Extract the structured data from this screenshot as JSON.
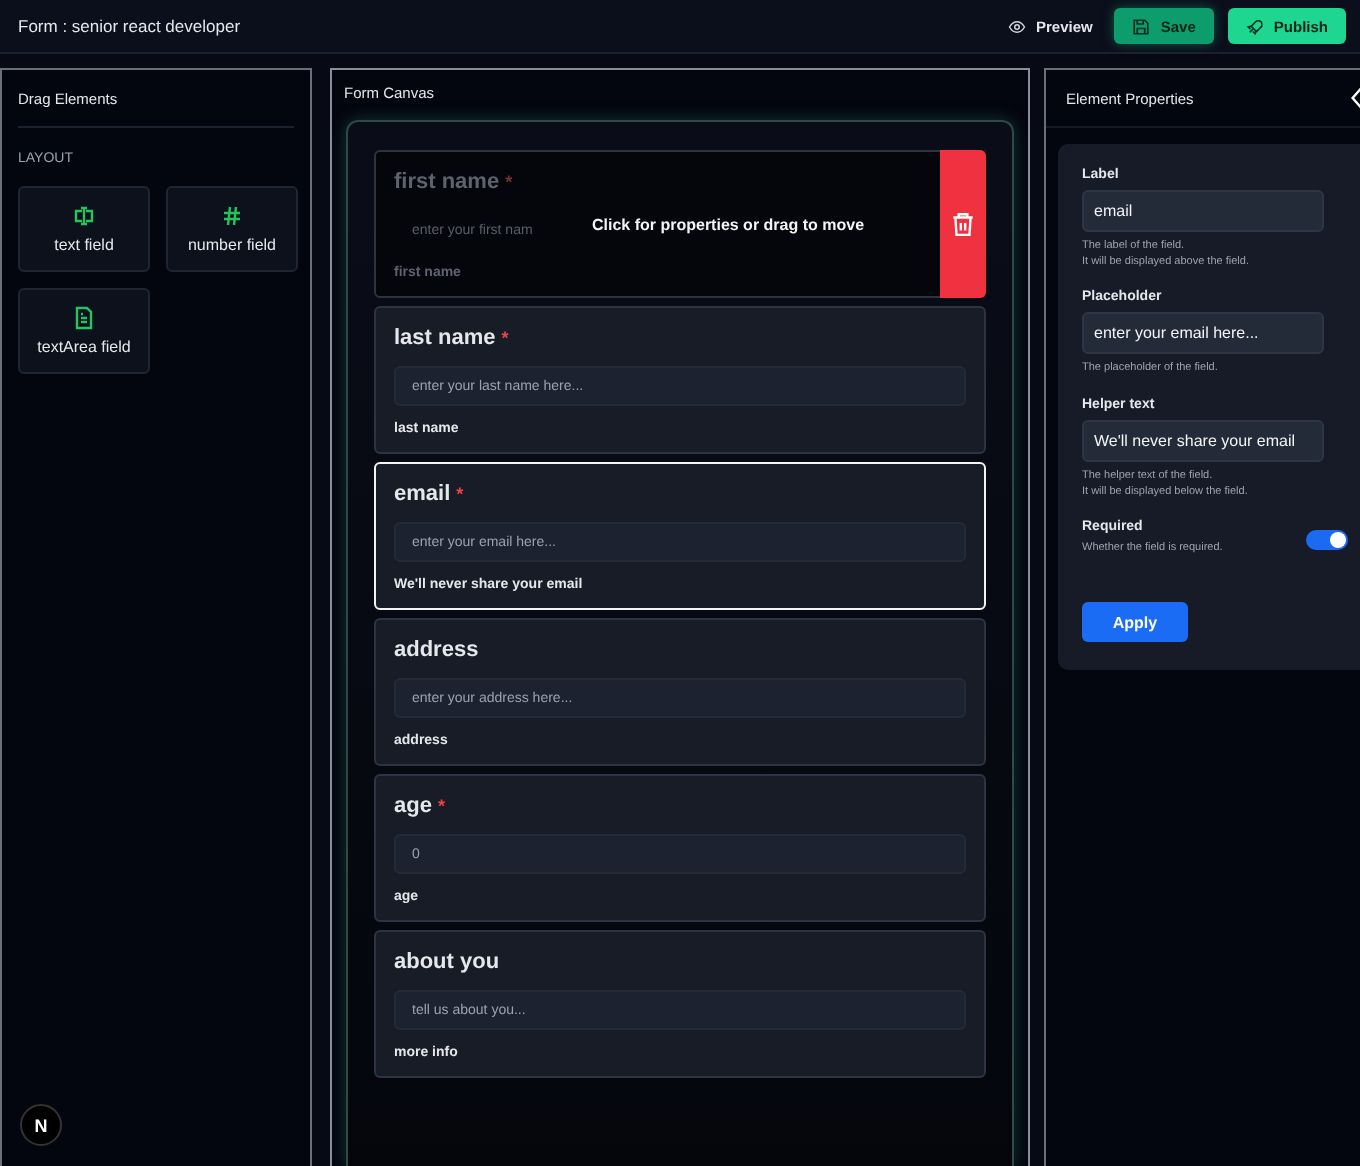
{
  "header": {
    "title": "Form : senior react developer",
    "buttons": [
      {
        "kind": "preview",
        "label": "Preview"
      },
      {
        "kind": "save",
        "label": "Save"
      },
      {
        "kind": "publish",
        "label": "Publish"
      }
    ]
  },
  "drag_panel": {
    "title": "Drag Elements",
    "section": "LAYOUT",
    "items": [
      {
        "kind": "text",
        "label": "text field"
      },
      {
        "kind": "number",
        "label": "number field"
      },
      {
        "kind": "textarea",
        "label": "textArea field"
      }
    ]
  },
  "canvas": {
    "title": "Form Canvas",
    "hover_hint": "Click for properties or drag to move",
    "required_mark": "*",
    "fields": [
      {
        "label": "first name",
        "required": true,
        "placeholder": "enter your first nam",
        "helper": "first name",
        "hovered": true,
        "selected": false
      },
      {
        "label": "last name",
        "required": true,
        "placeholder": "enter your last name here...",
        "helper": "last name",
        "hovered": false,
        "selected": false
      },
      {
        "label": "email",
        "required": true,
        "placeholder": "enter your email here...",
        "helper": "We'll never share your email",
        "hovered": false,
        "selected": true
      },
      {
        "label": "address",
        "required": false,
        "placeholder": "enter your address here...",
        "helper": "address",
        "hovered": false,
        "selected": false
      },
      {
        "label": "age",
        "required": true,
        "placeholder": "0",
        "helper": "age",
        "hovered": false,
        "selected": false
      },
      {
        "label": "about you",
        "required": false,
        "placeholder": "tell us about you...",
        "helper": "more info",
        "hovered": false,
        "selected": false
      }
    ]
  },
  "properties": {
    "title": "Element Properties",
    "inputs": [
      {
        "label": "Label",
        "value": "email",
        "description": "The label of the field.\nIt will be displayed above the field."
      },
      {
        "label": "Placeholder",
        "value": "enter your email here...",
        "description": "The placeholder of the field."
      },
      {
        "label": "Helper text",
        "value": "We'll never share your email",
        "description": "The helper text of the field.\nIt will be displayed below the field."
      }
    ],
    "required": {
      "label": "Required",
      "description": "Whether the field is required.",
      "on": true
    },
    "apply": "Apply"
  },
  "dev_badge": "N"
}
